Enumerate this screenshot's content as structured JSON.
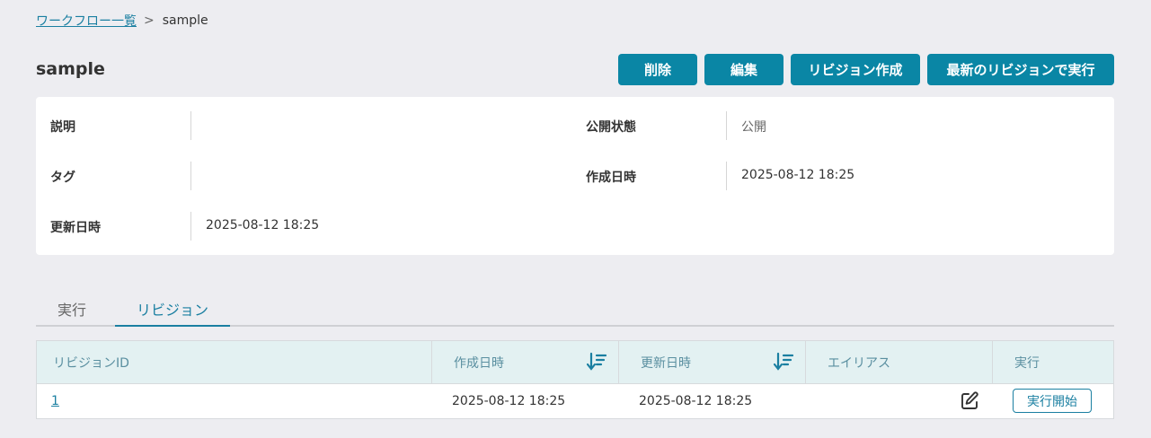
{
  "breadcrumb": {
    "parent": "ワークフロー一覧",
    "separator": ">",
    "current": "sample"
  },
  "page": {
    "title": "sample"
  },
  "actions": {
    "delete": "削除",
    "edit": "編集",
    "create_revision": "リビジョン作成",
    "run_latest": "最新のリビジョンで実行"
  },
  "info": {
    "description": {
      "label": "説明",
      "value": ""
    },
    "tags": {
      "label": "タグ",
      "value": ""
    },
    "updated": {
      "label": "更新日時",
      "value": "2025-08-12 18:25"
    },
    "visibility": {
      "label": "公開状態",
      "value": "公開"
    },
    "created": {
      "label": "作成日時",
      "value": "2025-08-12 18:25"
    }
  },
  "tabs": [
    {
      "label": "実行",
      "active": false
    },
    {
      "label": "リビジョン",
      "active": true
    }
  ],
  "table": {
    "columns": {
      "revision_id": "リビジョンID",
      "created": "作成日時",
      "updated": "更新日時",
      "alias": "エイリアス",
      "run": "実行"
    },
    "rows": [
      {
        "revision_id": "1",
        "created": "2025-08-12 18:25",
        "updated": "2025-08-12 18:25",
        "alias": "",
        "run_label": "実行開始"
      }
    ]
  },
  "colors": {
    "accent": "#0a86a5",
    "link": "#1a7fa1",
    "header_bg": "#e3f1f2",
    "page_bg": "#ededf1"
  },
  "icons": {
    "sort": "sort-descending-icon",
    "edit": "pencil-square-icon"
  }
}
